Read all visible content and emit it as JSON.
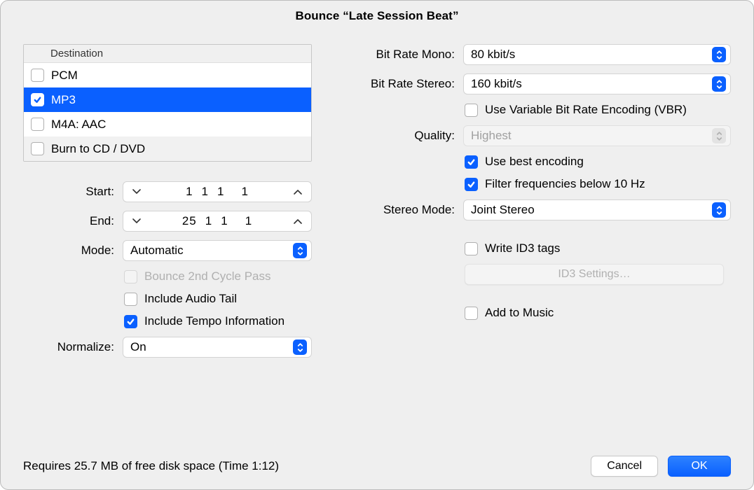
{
  "title": "Bounce “Late Session Beat”",
  "destination": {
    "header": "Destination",
    "items": [
      {
        "label": "PCM",
        "checked": false,
        "selected": false
      },
      {
        "label": "MP3",
        "checked": true,
        "selected": true
      },
      {
        "label": "M4A: AAC",
        "checked": false,
        "selected": false
      },
      {
        "label": "Burn to CD / DVD",
        "checked": false,
        "selected": false
      }
    ]
  },
  "left": {
    "start_label": "Start:",
    "start_values": [
      "1",
      "1",
      "1",
      "",
      "1"
    ],
    "end_label": "End:",
    "end_values": [
      "25",
      "1",
      "1",
      "",
      "1"
    ],
    "mode_label": "Mode:",
    "mode_value": "Automatic",
    "bounce2nd": "Bounce 2nd Cycle Pass",
    "include_tail": "Include Audio Tail",
    "include_tempo": "Include Tempo Information",
    "normalize_label": "Normalize:",
    "normalize_value": "On"
  },
  "right": {
    "bit_mono_label": "Bit Rate Mono:",
    "bit_mono_value": "80 kbit/s",
    "bit_stereo_label": "Bit Rate Stereo:",
    "bit_stereo_value": "160 kbit/s",
    "vbr": "Use Variable Bit Rate Encoding (VBR)",
    "quality_label": "Quality:",
    "quality_value": "Highest",
    "best_encoding": "Use best encoding",
    "filter_freq": "Filter frequencies below 10 Hz",
    "stereo_mode_label": "Stereo Mode:",
    "stereo_mode_value": "Joint Stereo",
    "write_id3": "Write ID3 tags",
    "id3_button": "ID3 Settings…",
    "add_music": "Add to Music"
  },
  "footer": {
    "status": "Requires 25.7 MB of free disk space  (Time 1:12)",
    "cancel": "Cancel",
    "ok": "OK"
  }
}
